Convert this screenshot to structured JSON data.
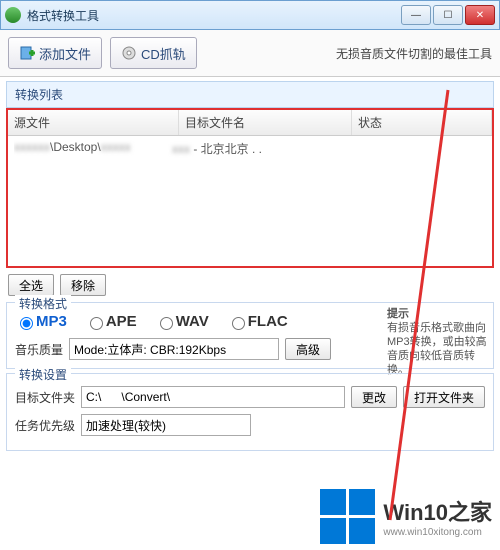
{
  "window": {
    "title": "格式转换工具"
  },
  "toolbar": {
    "add_file": "添加文件",
    "cd_grab": "CD抓轨",
    "subtitle": "无损音质文件切割的最佳工具"
  },
  "list": {
    "title": "转换列表",
    "headers": {
      "source": "源文件",
      "target": "目标文件名",
      "status": "状态"
    },
    "row": {
      "source": "\\Desktop\\",
      "target": "- 北京北京 . .",
      "status": ""
    }
  },
  "buttons": {
    "select_all": "全选",
    "remove": "移除"
  },
  "format": {
    "group_title": "转换格式",
    "opts": {
      "mp3": "MP3",
      "ape": "APE",
      "wav": "WAV",
      "flac": "FLAC"
    },
    "tip_title": "提示",
    "tip_body": "有损音乐格式歌曲向MP3转换，或由较高音质向较低音质转换。",
    "quality_label": "音乐质量",
    "quality_value": "Mode:立体声: CBR:192Kbps",
    "advanced": "高级"
  },
  "settings": {
    "group_title": "转换设置",
    "target_label": "目标文件夹",
    "target_value": "C:\\      \\Convert\\",
    "change": "更改",
    "open_folder": "打开文件夹",
    "priority_label": "任务优先级",
    "priority_value": "加速处理(较快)"
  },
  "watermark": {
    "title": "Win10之家",
    "url": "www.win10xitong.com"
  }
}
